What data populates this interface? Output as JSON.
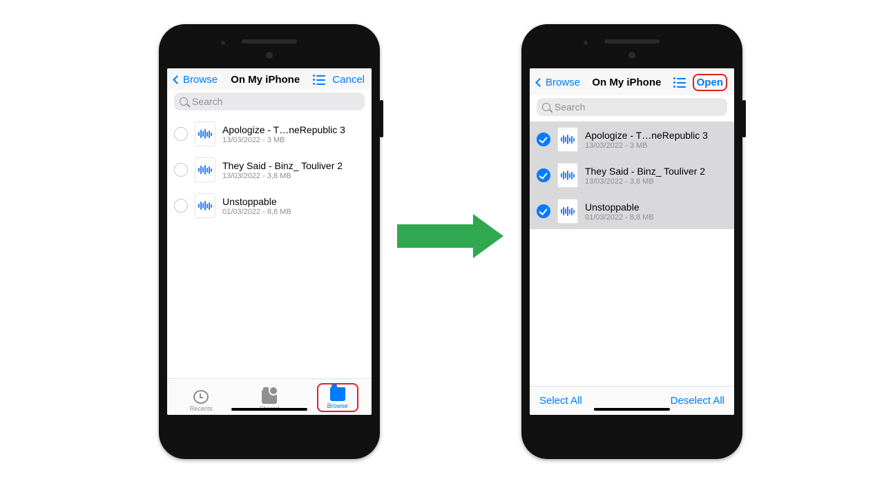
{
  "nav": {
    "back": "Browse",
    "title": "On My iPhone",
    "cancel": "Cancel",
    "open": "Open"
  },
  "search": {
    "placeholder": "Search"
  },
  "files": [
    {
      "name": "Apologize - T…neRepublic 3",
      "sub": "13/03/2022 - 3 MB"
    },
    {
      "name": "They Said - Binz_ Touliver 2",
      "sub": "13/03/2022 - 3,8 MB"
    },
    {
      "name": "Unstoppable",
      "sub": "01/03/2022 - 8,8 MB"
    }
  ],
  "tabs": {
    "recents": "Recents",
    "shared": "Shared",
    "browse": "Browse"
  },
  "toolbar": {
    "selectAll": "Select All",
    "deselectAll": "Deselect All"
  }
}
